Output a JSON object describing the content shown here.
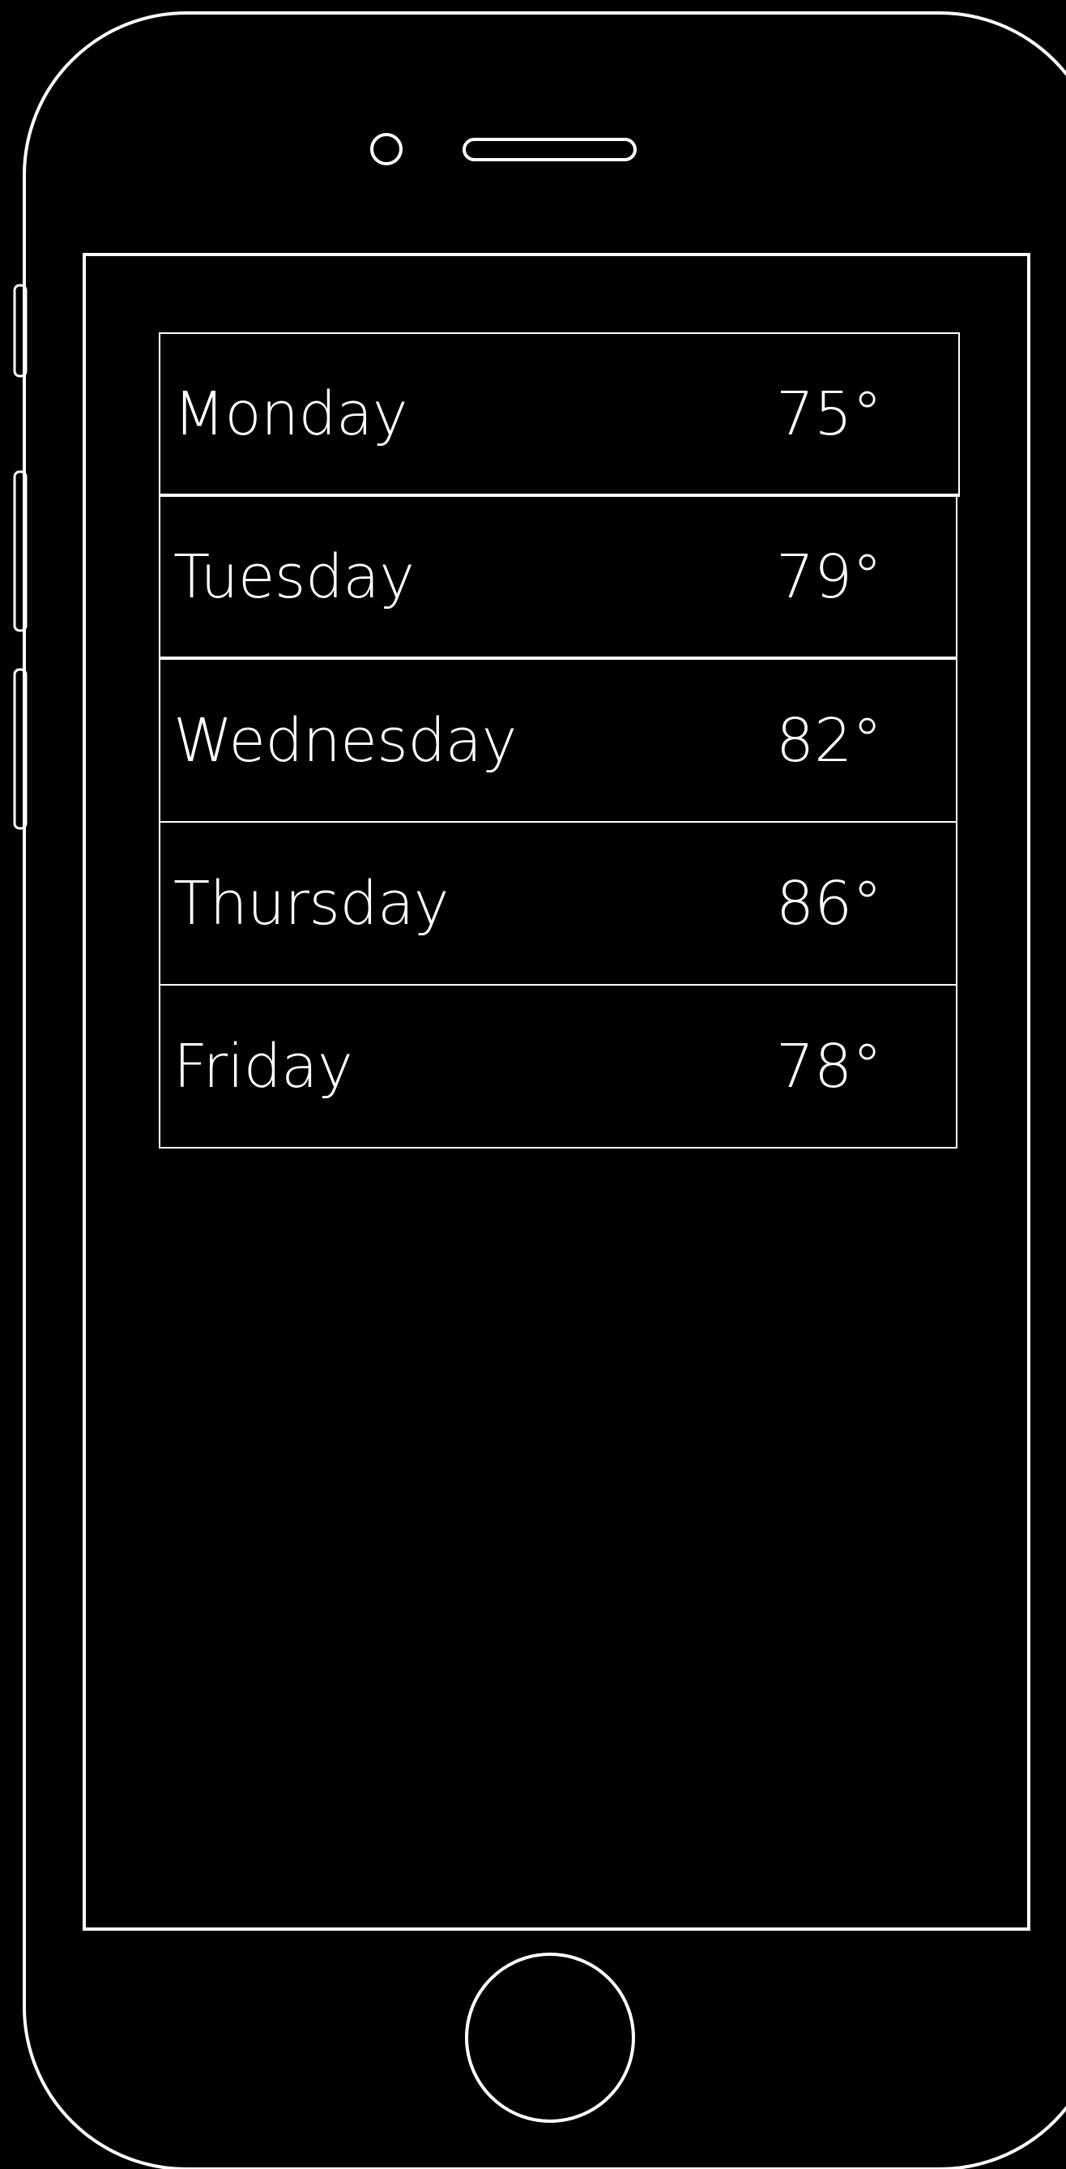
{
  "forecast": {
    "days": [
      {
        "day": "Monday",
        "temp": "75°"
      },
      {
        "day": "Tuesday",
        "temp": "79°"
      },
      {
        "day": "Wednesday",
        "temp": "82°"
      },
      {
        "day": "Thursday",
        "temp": "86°"
      },
      {
        "day": "Friday",
        "temp": "78°"
      }
    ]
  },
  "colors": {
    "background": "#000000",
    "outline": "#ffffff",
    "text": "#ffffff"
  }
}
